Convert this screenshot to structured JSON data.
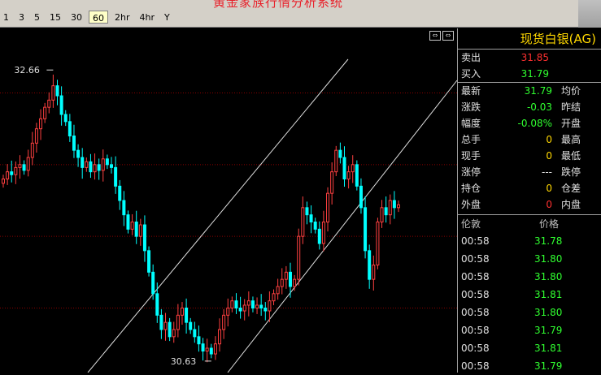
{
  "title": "黄金家族行情分析系统",
  "timeframes": [
    {
      "label": "1",
      "active": false
    },
    {
      "label": "3",
      "active": false
    },
    {
      "label": "5",
      "active": false
    },
    {
      "label": "15",
      "active": false
    },
    {
      "label": "30",
      "active": false
    },
    {
      "label": "60",
      "active": true
    },
    {
      "label": "2hr",
      "active": false
    },
    {
      "label": "4hr",
      "active": false
    },
    {
      "label": "Y",
      "active": false
    }
  ],
  "chart": {
    "high_label": "32.66",
    "low_label": "30.63",
    "colors": {
      "up": "#ff4040",
      "down": "#00ffff",
      "grid": "#8b0000",
      "trend": "#e0e0e0"
    }
  },
  "chart_data": {
    "type": "candlestick",
    "ylim": [
      30.55,
      32.95
    ],
    "high": 32.66,
    "low": 30.63,
    "closes": [
      31.9,
      31.95,
      31.93,
      31.98,
      32.0,
      31.96,
      32.05,
      32.15,
      32.25,
      32.32,
      32.4,
      32.45,
      32.55,
      32.48,
      32.35,
      32.3,
      32.2,
      32.1,
      32.05,
      31.98,
      32.02,
      31.95,
      32.0,
      31.96,
      32.04,
      32.0,
      31.98,
      31.85,
      31.75,
      31.65,
      31.55,
      31.6,
      31.5,
      31.58,
      31.4,
      31.25,
      31.1,
      30.95,
      30.85,
      30.9,
      30.8,
      30.85,
      30.95,
      31.0,
      30.9,
      30.85,
      30.8,
      30.75,
      30.7,
      30.72,
      30.68,
      30.75,
      30.85,
      30.95,
      31.0,
      31.05,
      31.0,
      30.98,
      31.02,
      31.05,
      31.0,
      31.02,
      31.0,
      30.98,
      31.05,
      31.1,
      31.15,
      31.2,
      31.25,
      31.15,
      31.2,
      31.5,
      31.7,
      31.65,
      31.6,
      31.55,
      31.45,
      31.6,
      31.8,
      31.95,
      32.1,
      32.05,
      31.9,
      31.95,
      32.0,
      31.85,
      31.7,
      31.4,
      31.2,
      31.3,
      31.6,
      31.7,
      31.65,
      31.75,
      31.7,
      31.72
    ]
  },
  "panel": {
    "symbol": "现货白银(AG)",
    "sell": {
      "label": "卖出",
      "value": "31.85"
    },
    "buy": {
      "label": "买入",
      "value": "31.79"
    },
    "stats": [
      {
        "l1": "最新",
        "v": "31.79",
        "l2": "均价",
        "c": "green"
      },
      {
        "l1": "涨跌",
        "v": "-0.03",
        "l2": "昨结",
        "c": "green"
      },
      {
        "l1": "幅度",
        "v": "-0.08%",
        "l2": "开盘",
        "c": "green"
      },
      {
        "l1": "总手",
        "v": "0",
        "l2": "最高",
        "c": "yellow"
      },
      {
        "l1": "现手",
        "v": "0",
        "l2": "最低",
        "c": "yellow"
      },
      {
        "l1": "涨停",
        "v": "---",
        "l2": "跌停",
        "c": "white"
      },
      {
        "l1": "持仓",
        "v": "0",
        "l2": "仓差",
        "c": "yellow"
      },
      {
        "l1": "外盘",
        "v": "0",
        "l2": "内盘",
        "c": "red"
      }
    ],
    "ticks_header": {
      "time": "伦敦",
      "price": "价格"
    },
    "ticks": [
      {
        "time": "00:58",
        "price": "31.78"
      },
      {
        "time": "00:58",
        "price": "31.80"
      },
      {
        "time": "00:58",
        "price": "31.80"
      },
      {
        "time": "00:58",
        "price": "31.81"
      },
      {
        "time": "00:58",
        "price": "31.80"
      },
      {
        "time": "00:58",
        "price": "31.79"
      },
      {
        "time": "00:58",
        "price": "31.81"
      },
      {
        "time": "00:58",
        "price": "31.79"
      }
    ]
  }
}
